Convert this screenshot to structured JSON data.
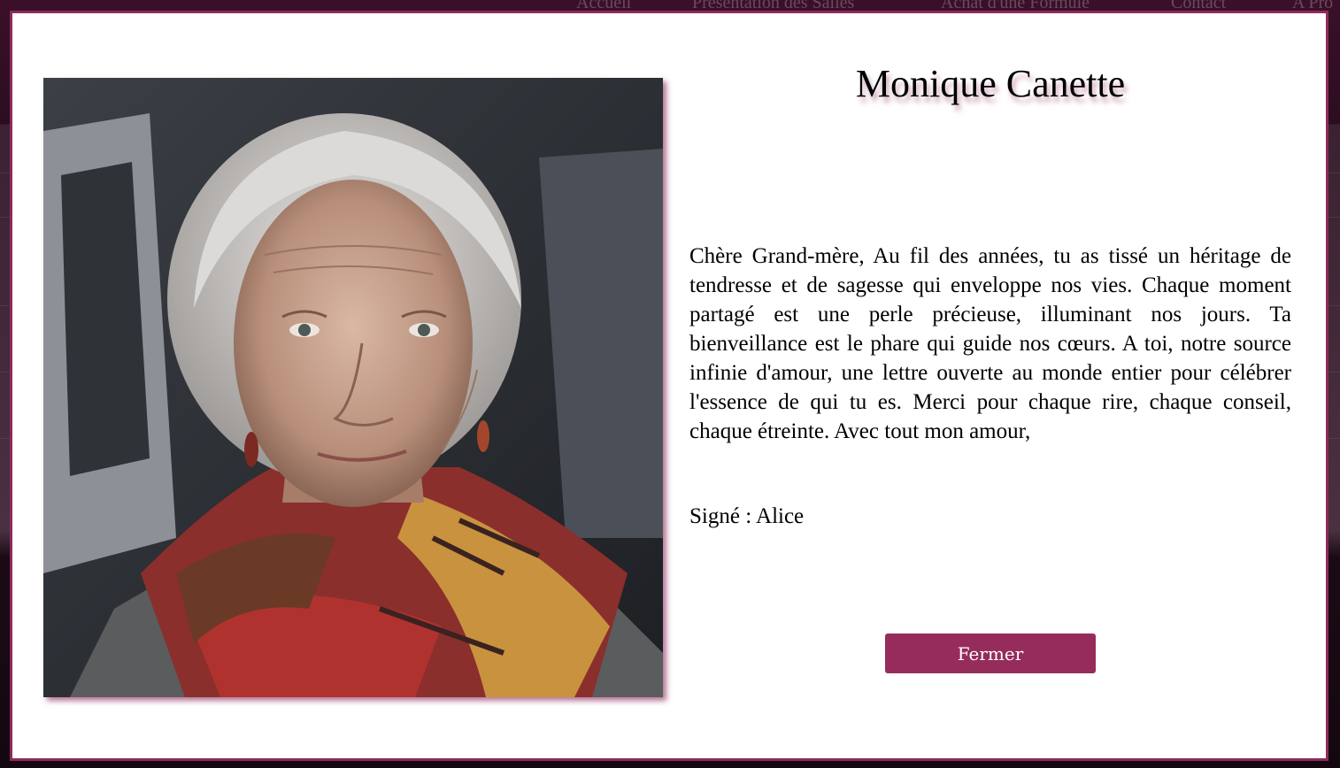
{
  "background": {
    "nav": [
      "Accueil",
      "Présentation des Salles",
      "Achat d'une Formule",
      "Contact",
      "A Pro"
    ]
  },
  "modal": {
    "name": "Monique Canette",
    "message": "Chère Grand-mère, Au fil des années, tu as tissé un héritage de tendresse et de sagesse qui enveloppe nos vies. Chaque moment partagé est une perle précieuse, illuminant nos jours. Ta bienveillance est le phare qui guide nos cœurs. A toi, notre source infinie d'amour, une lettre ouverte au monde entier pour célébrer l'essence de qui tu es. Merci pour chaque rire, chaque conseil, chaque étreinte. Avec tout mon amour,",
    "signature": "Signé : Alice",
    "close_label": "Fermer"
  },
  "colors": {
    "accent": "#962c5c",
    "border": "#8e2a5c",
    "backdrop": "#2c0d20"
  }
}
